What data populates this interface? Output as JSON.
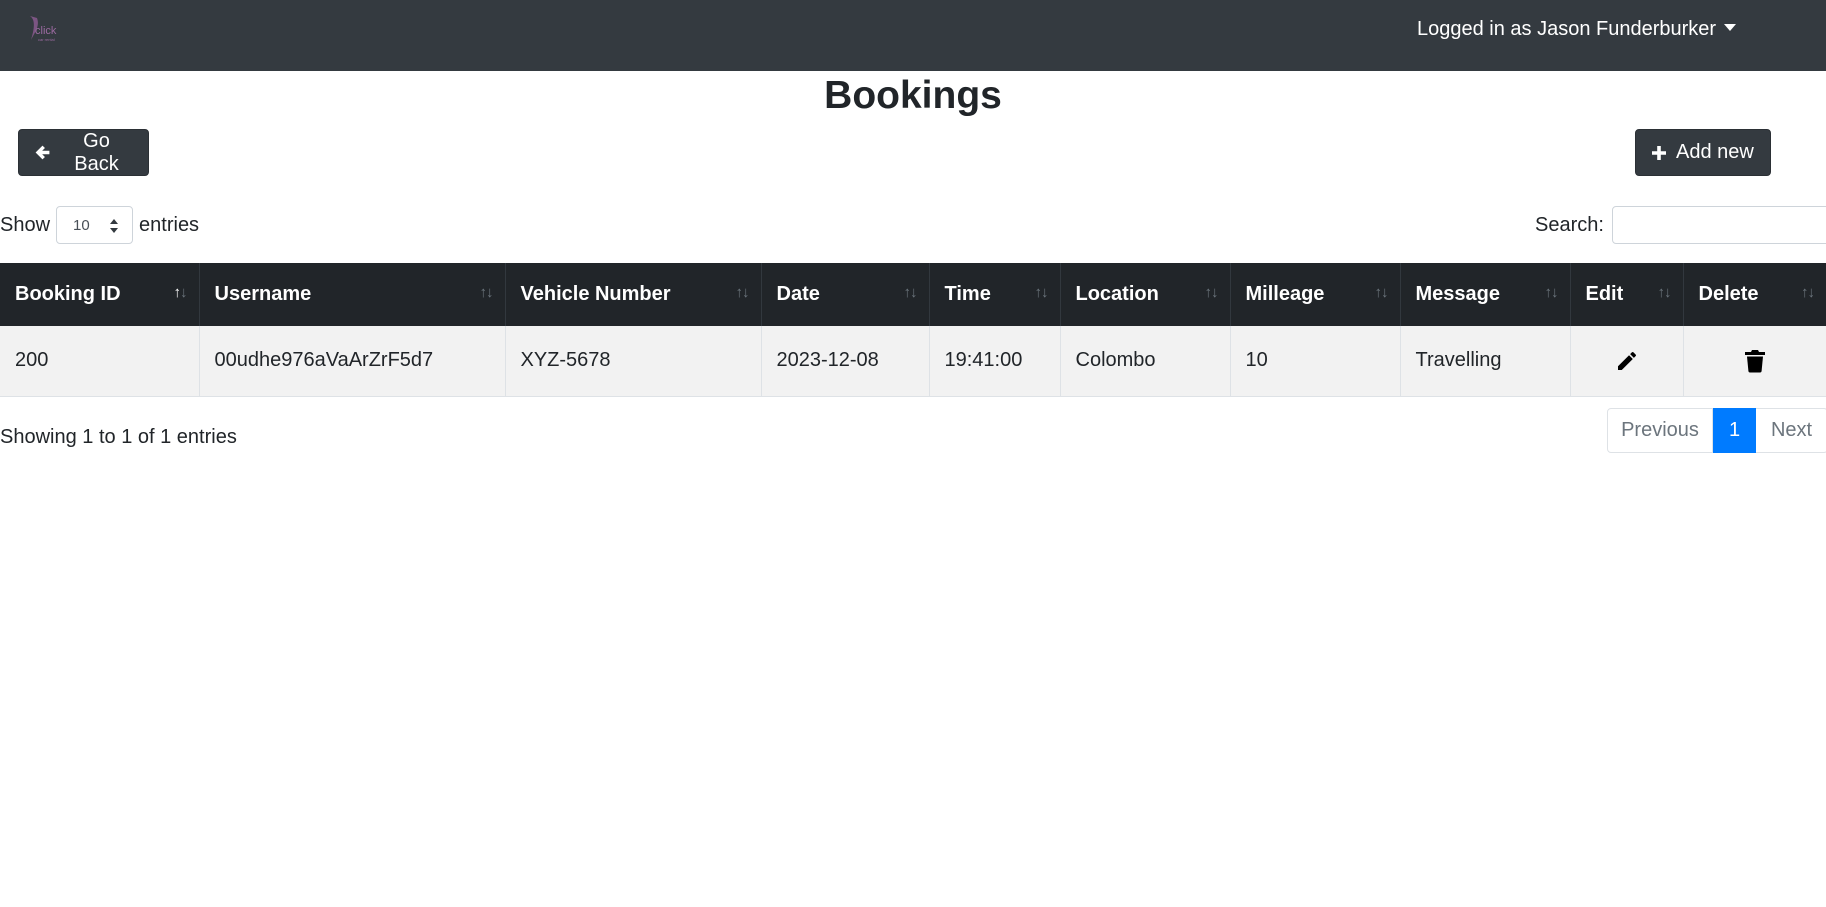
{
  "navbar": {
    "user_label": "Logged in as Jason Funderburker"
  },
  "page": {
    "title": "Bookings"
  },
  "actions": {
    "back_label": "Go Back",
    "add_label": "Add new"
  },
  "table_controls": {
    "show_label": "Show",
    "entries_value": "10",
    "entries_label": "entries",
    "search_label": "Search:",
    "search_value": ""
  },
  "table": {
    "columns": [
      "Booking ID",
      "Username",
      "Vehicle Number",
      "Date",
      "Time",
      "Location",
      "Milleage",
      "Message",
      "Edit",
      "Delete"
    ],
    "rows": [
      {
        "booking_id": "200",
        "username": "00udhe976aVaArZrF5d7",
        "vehicle_number": "XYZ-5678",
        "date": "2023-12-08",
        "time": "19:41:00",
        "location": "Colombo",
        "milleage": "10",
        "message": "Travelling",
        "edit_icon": "pencil-icon",
        "delete_icon": "trash-icon"
      }
    ]
  },
  "footer": {
    "info": "Showing 1 to 1 of 1 entries",
    "pagination": {
      "previous": "Previous",
      "current": "1",
      "next": "Next"
    }
  },
  "colors": {
    "navbar": "#343a40",
    "table_header": "#212529",
    "active_page": "#007bff",
    "row_stripe": "#f2f2f2"
  }
}
